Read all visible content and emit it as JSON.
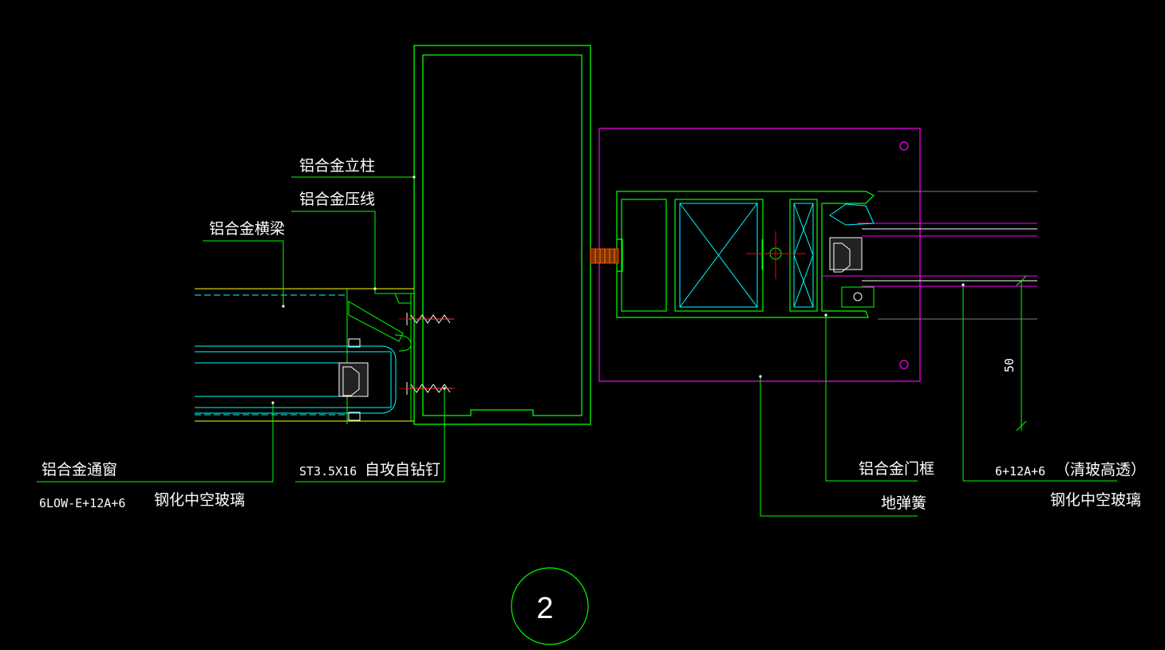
{
  "drawing": {
    "background": "#000000",
    "colors": {
      "green": "#00ff00",
      "cyan": "#00ffff",
      "white": "#ffffff",
      "magenta": "#ff00ff",
      "yellow": "#ffff00",
      "red": "#ff0000",
      "gray": "#808080"
    },
    "detail_number": "2",
    "dimension": "50"
  },
  "labels": {
    "mullion": "铝合金立柱",
    "pressure_strip": "铝合金压线",
    "transom": "铝合金横梁",
    "vent_window": "铝合金通窗",
    "glass_spec_left": "6LOW-E+12A+6",
    "tempered_glass_left": "钢化中空玻璃",
    "screw_spec": "ST3.5X16",
    "screw_name": "自攻自钻钉",
    "door_frame": "铝合金门框",
    "floor_spring": "地弹簧",
    "glass_spec_right": "6+12A+6",
    "glass_note_right": "（清玻高透）",
    "tempered_glass_right": "钢化中空玻璃"
  }
}
